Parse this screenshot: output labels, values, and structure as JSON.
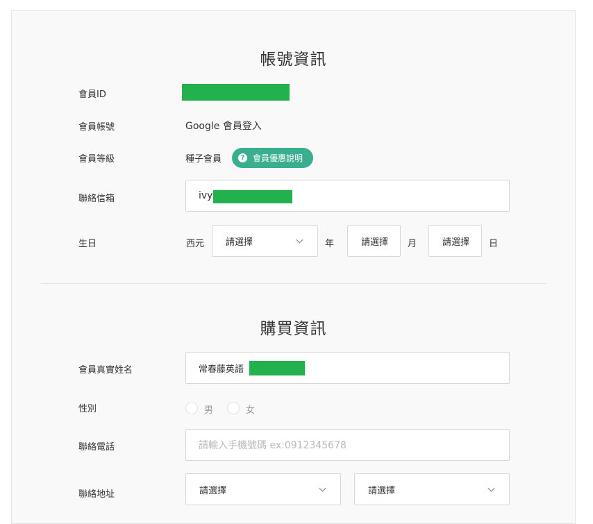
{
  "account": {
    "title": "帳號資訊",
    "member_id_label": "會員ID",
    "member_account_label": "會員帳號",
    "member_account_value": "Google 會員登入",
    "member_level_label": "會員等級",
    "member_level_value": "種子會員",
    "benefits_button": "會員優惠說明",
    "email_label": "聯絡信箱",
    "email_value": "ivy",
    "birthday_label": "生日",
    "era_label": "西元",
    "year_select": "請選擇",
    "year_unit": "年",
    "month_select": "請選擇",
    "month_unit": "月",
    "day_select": "請選擇",
    "day_unit": "日"
  },
  "purchase": {
    "title": "購買資訊",
    "real_name_label": "會員真實姓名",
    "real_name_value": "常春藤英語",
    "gender_label": "性別",
    "gender_options": [
      "男",
      "女"
    ],
    "phone_label": "聯絡電話",
    "phone_placeholder": "請輸入手機號碼 ex:0912345678",
    "address_label": "聯絡地址",
    "city_select": "請選擇",
    "district_select": "請選擇"
  },
  "colors": {
    "accent": "#3aaf8f",
    "redaction": "#22b14c"
  }
}
